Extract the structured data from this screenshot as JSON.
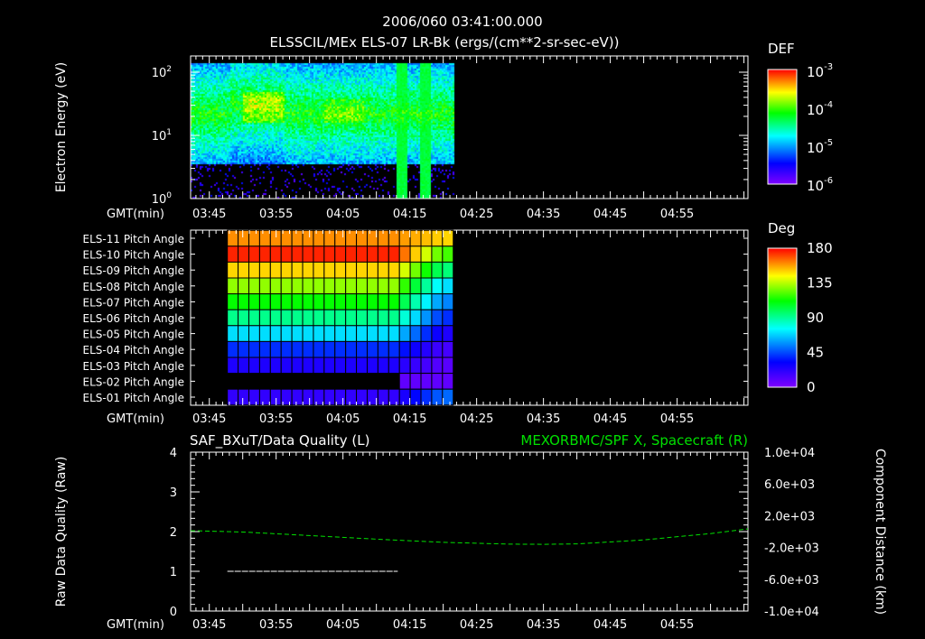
{
  "header": {
    "timestamp": "2006/060 03:41:00.000",
    "title": "ELSSCIL/MEx ELS-07 LR-Bk  (ergs/(cm**2-sr-sec-eV))"
  },
  "colors": {
    "background": "#000000",
    "axes": "#ffffff",
    "spacecraft_series": "#00ff00"
  },
  "chart_data": [
    {
      "type": "heatmap",
      "name": "electron-spectrogram",
      "ylabel": "Electron Energy (eV)",
      "xlabel": "GMT(min)",
      "yscale": "log",
      "ylim": [
        1,
        180
      ],
      "ytick_labels": [
        {
          "base": "10",
          "exp": "0"
        },
        {
          "base": "10",
          "exp": "1"
        },
        {
          "base": "10",
          "exp": "2"
        }
      ],
      "ytick_values": [
        1,
        10,
        100
      ],
      "xlim_minutes": [
        222.2,
        305.6
      ],
      "xtick_labels": [
        "03:45",
        "03:55",
        "04:05",
        "04:15",
        "04:25",
        "04:35",
        "04:45",
        "04:55"
      ],
      "xtick_values": [
        225,
        235,
        245,
        255,
        265,
        275,
        285,
        295
      ],
      "data_time_range": [
        222.2,
        261.5
      ],
      "peak_energy_band_eV": [
        15,
        50
      ],
      "colorbar": {
        "title": "DEF",
        "scale": "log",
        "range": [
          1e-06,
          0.001
        ],
        "tick_labels": [
          {
            "base": "10",
            "exp": "-3"
          },
          {
            "base": "10",
            "exp": "-4"
          },
          {
            "base": "10",
            "exp": "-5"
          },
          {
            "base": "10",
            "exp": "-6"
          }
        ]
      }
    },
    {
      "type": "heatmap",
      "name": "pitch-angle",
      "xlabel": "GMT(min)",
      "rows": [
        "ELS-11 Pitch Angle",
        "ELS-10 Pitch Angle",
        "ELS-09 Pitch Angle",
        "ELS-08 Pitch Angle",
        "ELS-07 Pitch Angle",
        "ELS-06 Pitch Angle",
        "ELS-05 Pitch Angle",
        "ELS-04 Pitch Angle",
        "ELS-03 Pitch Angle",
        "ELS-02 Pitch Angle",
        "ELS-01 Pitch Angle"
      ],
      "row_base_angles_deg": [
        160,
        175,
        150,
        130,
        112,
        92,
        70,
        40,
        25,
        null,
        20
      ],
      "row_late_angles_deg": [
        150,
        120,
        95,
        70,
        55,
        40,
        25,
        15,
        10,
        8,
        50
      ],
      "data_time_range": [
        227.7,
        261.5
      ],
      "transition_minute": 252,
      "xtick_labels": [
        "03:45",
        "03:55",
        "04:05",
        "04:15",
        "04:25",
        "04:35",
        "04:45",
        "04:55"
      ],
      "xtick_values": [
        225,
        235,
        245,
        255,
        265,
        275,
        285,
        295
      ],
      "colorbar": {
        "title": "Deg",
        "range": [
          0,
          180
        ],
        "tick_labels": [
          "180",
          "135",
          "90",
          "45",
          "0"
        ]
      }
    },
    {
      "type": "line",
      "name": "quality-and-position",
      "title_left": "SAF_BXuT/Data Quality (L)",
      "title_right": "MEXORBMC/SPF X, Spacecraft (R)",
      "ylabel_left": "Raw Data Quality (Raw)",
      "ylabel_right": "Component Distance (km)",
      "xlabel": "GMT(min)",
      "ylim_left": [
        0,
        4
      ],
      "yticks_left": [
        "0",
        "1",
        "2",
        "3",
        "4"
      ],
      "ylim_right": [
        -10000,
        10000
      ],
      "yticks_right": [
        "1.0e+04",
        "6.0e+03",
        "2.0e+03",
        "-2.0e+03",
        "-6.0e+03",
        "-1.0e+04"
      ],
      "xtick_labels": [
        "03:45",
        "03:55",
        "04:05",
        "04:15",
        "04:25",
        "04:35",
        "04:45",
        "04:55"
      ],
      "xtick_values": [
        225,
        235,
        245,
        255,
        265,
        275,
        285,
        295
      ],
      "series": [
        {
          "name": "Data Quality",
          "axis": "left",
          "segments": [
            {
              "x": [
                227.7,
                253.2
              ],
              "y": 1
            },
            {
              "x": [
                253.4,
                302.5
              ],
              "y": 0
            }
          ]
        },
        {
          "name": "SPF X, Spacecraft",
          "axis": "right",
          "x": [
            222.2,
            230,
            240,
            250,
            260,
            270,
            275,
            280,
            290,
            300,
            305.6
          ],
          "y": [
            120,
            -50,
            -500,
            -950,
            -1350,
            -1580,
            -1600,
            -1550,
            -1050,
            -250,
            340
          ]
        }
      ]
    }
  ]
}
